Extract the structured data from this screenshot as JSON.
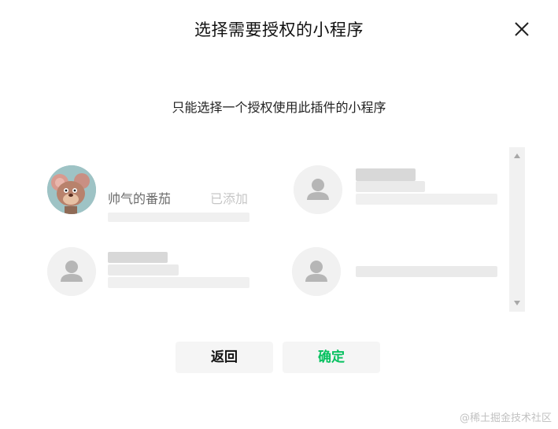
{
  "dialog": {
    "title": "选择需要授权的小程序",
    "subtitle": "只能选择一个授权使用此插件的小程序"
  },
  "items": [
    {
      "name": "帅气的番茄",
      "badge": "已添加",
      "avatar": "cartoon-mouse-avatar",
      "added": true
    },
    {
      "name": "",
      "badge": "",
      "avatar": "default-person-icon",
      "added": false
    },
    {
      "name": "",
      "badge": "",
      "avatar": "default-person-icon",
      "added": false
    },
    {
      "name": "",
      "badge": "",
      "avatar": "default-person-icon",
      "added": false
    }
  ],
  "buttons": {
    "back_label": "返回",
    "confirm_label": "确定"
  },
  "watermark": "@稀土掘金技术社区",
  "colors": {
    "confirm": "#07c160",
    "button_bg": "#f5f5f5",
    "scrollbar_track": "#f1f1f1"
  },
  "icons": {
    "close": "close-icon",
    "scroll_up": "scroll-up-arrow-icon",
    "scroll_down": "scroll-down-arrow-icon"
  }
}
